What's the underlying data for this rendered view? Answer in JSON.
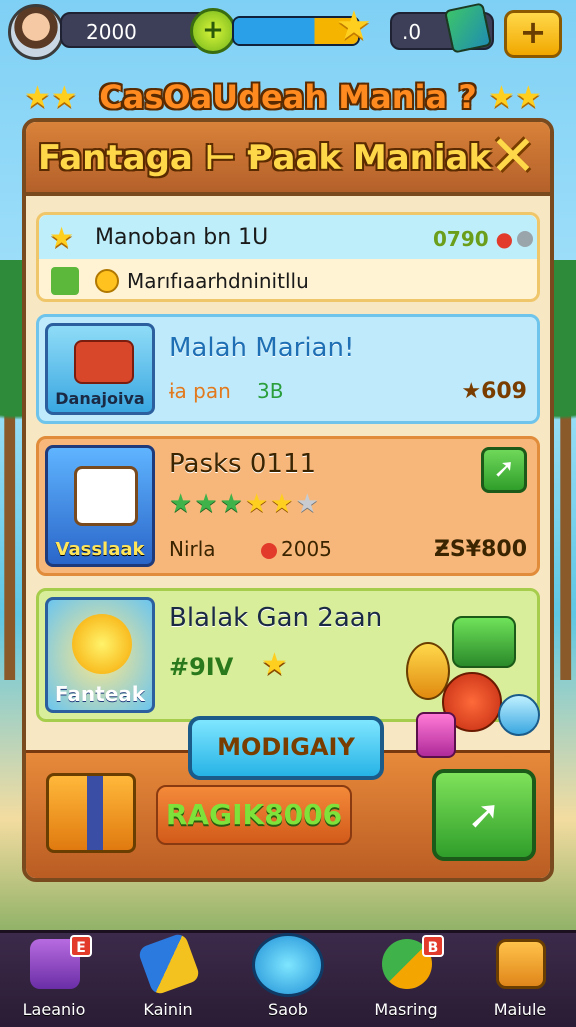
{
  "hud": {
    "coins": "2000",
    "gems": ".0",
    "xp_fraction": 0.65
  },
  "game_title": "CasOaUdeah Mania ?",
  "panel": {
    "title": "Fantaga ⊢ Ᵽaak Maniak",
    "info": {
      "label": "Manoban bn 1U",
      "value": "0790",
      "sub": "Marıfıaarhdninitllu"
    },
    "rows": [
      {
        "title": "Malah Marian!",
        "thumb_label": "Danajoiva",
        "meta_a": "ɨa pan",
        "meta_b": "3B",
        "price": "★609"
      },
      {
        "title": "Pasks 0111",
        "thumb_label": "Vasslaak",
        "meta_a": "Nirla",
        "meta_b": "2005",
        "price": "ƵS¥800",
        "stars_filled": 5,
        "stars_total": 6
      },
      {
        "title": "Blalak Gan 2aan",
        "thumb_label": "Fanteak",
        "meta_a": "#9IV"
      }
    ],
    "action_button": "MODIGAIY",
    "band_label": "RAGIK8006"
  },
  "nav": {
    "items": [
      {
        "label": "Laeanio",
        "badge": "E"
      },
      {
        "label": "Kainin"
      },
      {
        "label": "Saob"
      },
      {
        "label": "Masring",
        "badge": "B"
      },
      {
        "label": "Maiule"
      }
    ]
  },
  "colors": {
    "panel_border": "#7a4a1f",
    "title_orange": "#ff8a1f",
    "accent_green": "#2f9e2a",
    "accent_blue": "#26b3e6"
  }
}
